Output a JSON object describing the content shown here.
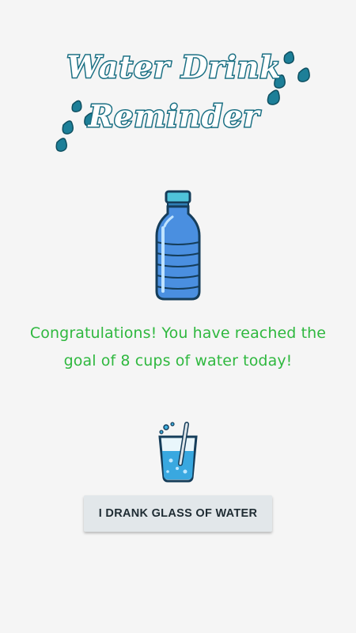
{
  "header": {
    "title_line1": "Water Drink",
    "title_line2": "Reminder",
    "title_stroke_color": "#1a6f83",
    "drop_color": "#1d7f98"
  },
  "bottle": {
    "icon": "water-bottle-icon",
    "body_color": "#4a90e2",
    "cap_color": "#4fc3d9"
  },
  "message": {
    "text": "Congratulations! You have reached the goal of 8 cups of water today!",
    "color": "#2fb83f"
  },
  "glass": {
    "icon": "water-glass-icon"
  },
  "actions": {
    "drink_button_label": "I DRANK GLASS OF WATER"
  }
}
